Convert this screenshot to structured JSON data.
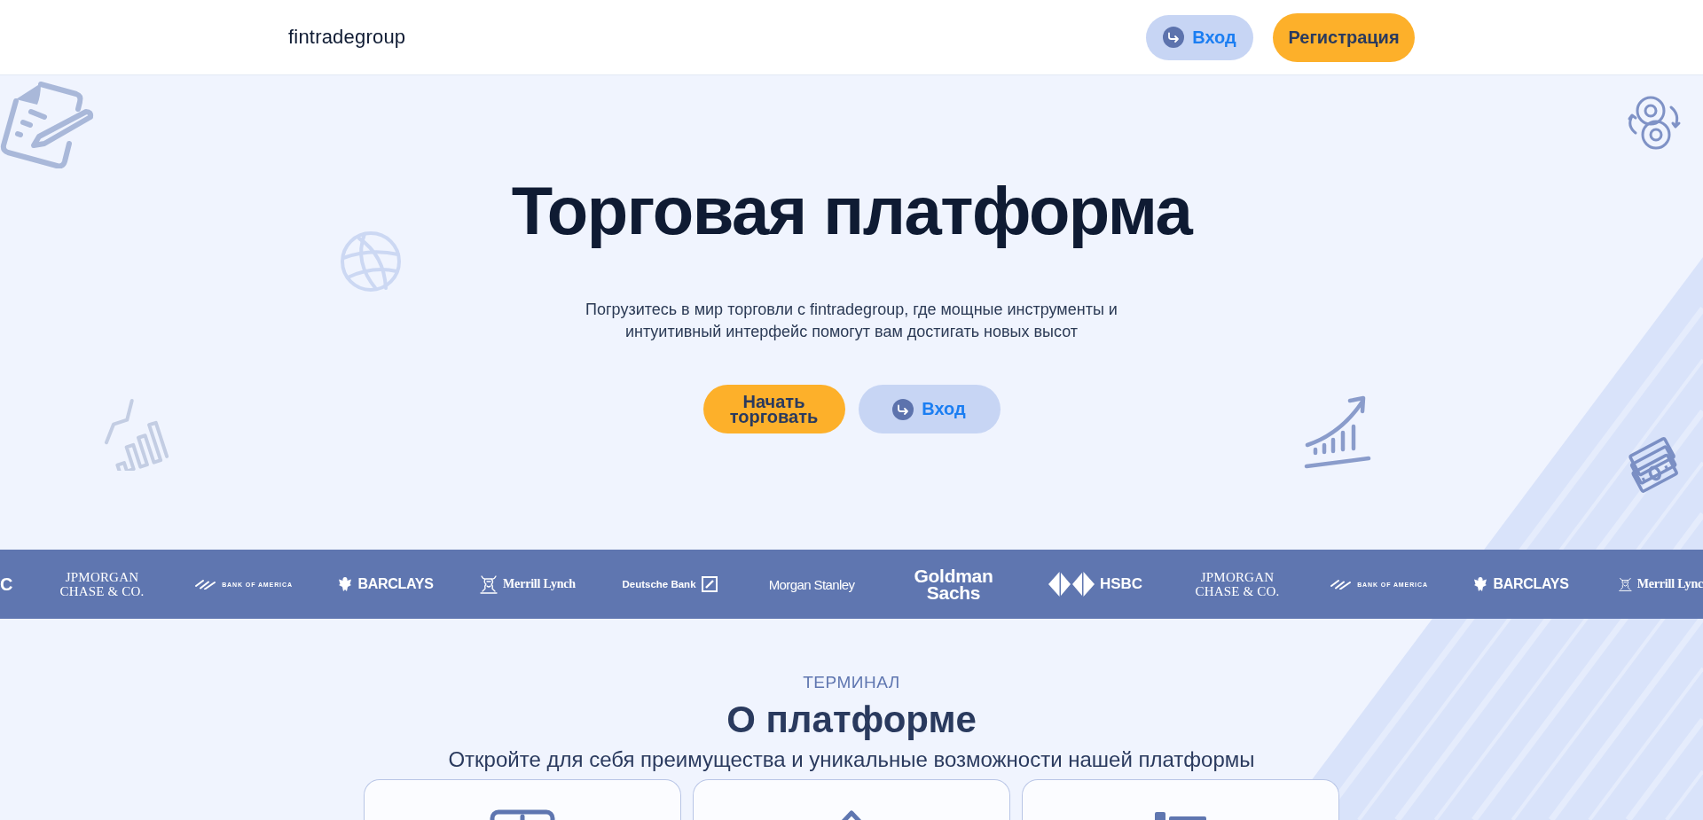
{
  "header": {
    "logo": "fintradegroup",
    "buttons": [
      {
        "label": "Вход",
        "kind": "secondary"
      },
      {
        "label": "Регистрация",
        "kind": "primary"
      }
    ]
  },
  "hero": {
    "title": "Торговая платформа",
    "subtitle": "Погрузитесь в мир торговли с fintradegroup, где мощные инструменты и интуитивный интерфейс помогут вам достигать новых высот",
    "buttons": [
      {
        "label": "Начать торговать",
        "kind": "primary"
      },
      {
        "label": "Вход",
        "kind": "secondary"
      }
    ]
  },
  "partners": [
    {
      "kind": "fragment",
      "lines": [
        "C"
      ]
    },
    {
      "kind": "serif",
      "lines": [
        "JPMORGAN",
        "CHASE & CO."
      ]
    },
    {
      "kind": "flag",
      "lines": [
        "BANK OF AMERICA"
      ]
    },
    {
      "kind": "eagle",
      "lines": [
        "BARCLAYS"
      ]
    },
    {
      "kind": "bull",
      "lines": [
        "Merrill Lynch"
      ]
    },
    {
      "kind": "slash",
      "lines": [
        "Deutsche Bank"
      ]
    },
    {
      "kind": "plain",
      "lines": [
        "Morgan Stanley"
      ]
    },
    {
      "kind": "stacked",
      "lines": [
        "Goldman",
        "Sachs"
      ]
    },
    {
      "kind": "hexagon",
      "lines": [
        "HSBC"
      ]
    },
    {
      "kind": "serif",
      "lines": [
        "JPMORGAN",
        "CHASE & CO."
      ]
    },
    {
      "kind": "flag",
      "lines": [
        "BANK OF AMERICA"
      ]
    },
    {
      "kind": "eagle",
      "lines": [
        "BARCLAYS"
      ]
    },
    {
      "kind": "bull",
      "lines": [
        "Merrill Lync"
      ]
    }
  ],
  "about": {
    "eyebrow": "ТЕРМИНАЛ",
    "title": "О платформе",
    "subtitle": "Откройте для себя преимущества и уникальные возможности нашей платформы"
  }
}
